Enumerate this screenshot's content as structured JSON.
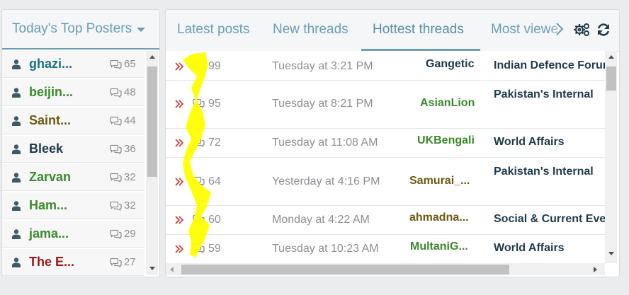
{
  "top_posters": {
    "title": "Today's Top Posters",
    "items": [
      {
        "name": "ghazi...",
        "count": "65",
        "color": "#1a6e8a"
      },
      {
        "name": "beijin...",
        "count": "48",
        "color": "#3a8a2a"
      },
      {
        "name": "Saint...",
        "count": "44",
        "color": "#6b5a10"
      },
      {
        "name": "Bleek",
        "count": "36",
        "color": "#1f3a4a"
      },
      {
        "name": "Zarvan",
        "count": "32",
        "color": "#3a8a2a"
      },
      {
        "name": "Ham...",
        "count": "32",
        "color": "#3a8a2a"
      },
      {
        "name": "jama...",
        "count": "29",
        "color": "#3a8a2a"
      },
      {
        "name": "The E...",
        "count": "27",
        "color": "#a01818"
      }
    ]
  },
  "tabs": {
    "items": [
      {
        "label": "Latest posts"
      },
      {
        "label": "New threads"
      },
      {
        "label": "Hottest threads"
      },
      {
        "label": "Most viewe"
      }
    ],
    "active": "Hottest threads"
  },
  "threads": [
    {
      "count": "99",
      "time": "Tuesday at 3:21 PM",
      "user": "Gangetic",
      "user_color": "#1f3a4a",
      "forum": "Indian Defence Forum"
    },
    {
      "count": "95",
      "time": "Tuesday at 8:21 PM",
      "user": "AsianLion",
      "user_color": "#3a8a2a",
      "forum": "Pakistan's Internal"
    },
    {
      "count": "72",
      "time": "Tuesday at 11:08 AM",
      "user": "UKBengali",
      "user_color": "#3a8a2a",
      "forum": "World Affairs"
    },
    {
      "count": "64",
      "time": "Yesterday at 4:16 PM",
      "user": "Samurai_...",
      "user_color": "#6b5a10",
      "forum": "Pakistan's Internal"
    },
    {
      "count": "60",
      "time": "Monday at 4:22 AM",
      "user": "ahmadna...",
      "user_color": "#6b5a10",
      "forum": "Social & Current Events"
    },
    {
      "count": "59",
      "time": "Tuesday at 10:23 AM",
      "user": "MultaniG...",
      "user_color": "#3a8a2a",
      "forum": "World Affairs"
    }
  ],
  "colors": {
    "accent": "#6a9fb5",
    "chevron": "#d32f2f",
    "highlight": "#ffff00"
  },
  "icons": {
    "user": "user-icon",
    "messages": "messages-icon",
    "chevron": "double-chevron-right-icon",
    "gear": "gears-icon",
    "refresh": "refresh-icon"
  }
}
